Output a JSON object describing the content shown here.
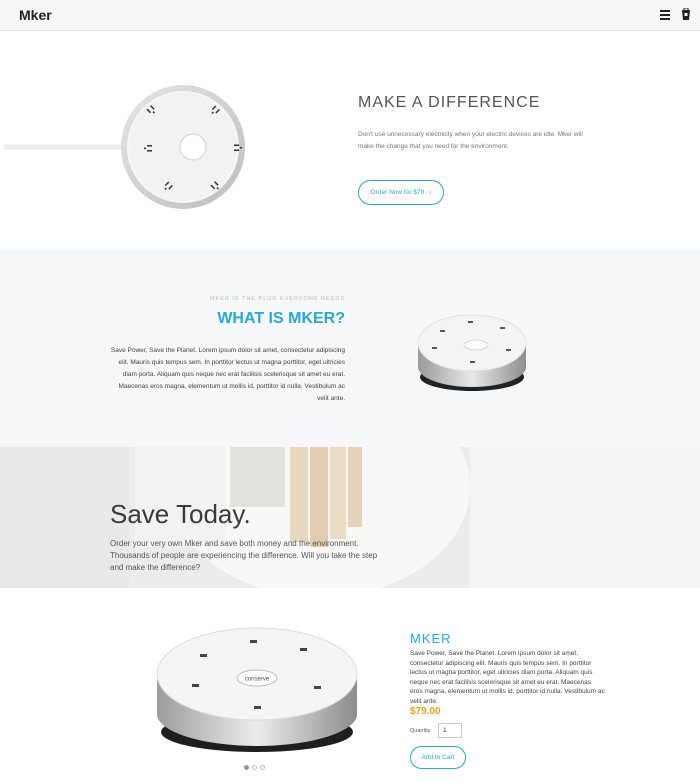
{
  "header": {
    "brand": "Mker",
    "menu_icon": "hamburger-icon",
    "cart_icon": "cart-icon"
  },
  "hero": {
    "title": "MAKE A DIFFERENCE",
    "text": "Don't use unnecessary electricity when your electric devices are idle. Mker will make the change that you need for the environment.",
    "button_label": "Order Now for $79",
    "button_icon": "chevron-right-icon"
  },
  "what": {
    "eyebrow": "MKER IS THE PLUG EVERYONE NEEDS",
    "title": "WHAT IS MKER?",
    "text": "Save Power, Save the Planet. Lorem ipsum dolor sit amet, consectetur adipiscing elit. Mauris quis tempus sem. In porttitor lectus ut magna porttitor, eget ultricies diam porta. Aliquam quis neque nec erat facilisis scelerisque sit amet eu erat. Maecenas eros magna, elementum ut mollis id, porttitor id nulla. Vestibulum ac velit ante."
  },
  "save": {
    "title": "Save Today.",
    "text": "Order your very own Mker and save both money and the environment. Thousands of people are experiencing the difference. Will you take the step and make the difference?"
  },
  "product": {
    "name": "MKER",
    "description": "Save Power, Save the Planet. Lorem ipsum dolor sit amet, consectetur adipiscing elit. Mauris quis tempus sem. In porttitor lectus ut magna porttitor, eget ultricies diam porta. Aliquam quis neque nec erat facilisis scelerisque sit amet eu erat. Maecenas eros magna, elementum ut mollis id, porttitor id nulla. Vestibulum ac velit ante.",
    "price": "$79.00",
    "quantity_label": "Quantity",
    "quantity_value": "1",
    "cart_button": "Add to Cart",
    "brand_mark": "conserve",
    "carousel": {
      "slides": 3,
      "active": 1
    }
  },
  "colors": {
    "accent": "#29a9d4",
    "price": "#f0a020",
    "section_alt": "#f5f7f8"
  }
}
